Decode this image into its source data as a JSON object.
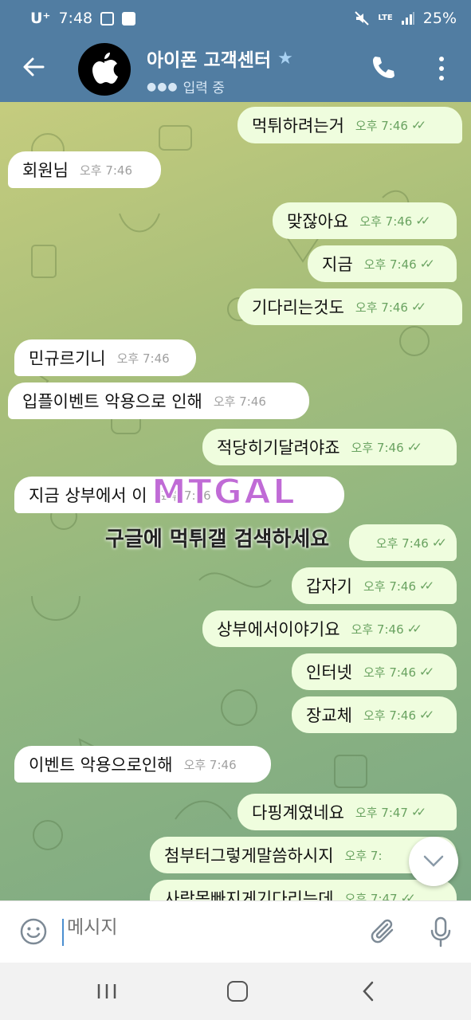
{
  "status_bar": {
    "carrier": "U⁺",
    "time": "7:48",
    "network": "LTE",
    "battery": "25%"
  },
  "header": {
    "title": "아이폰 고객센터",
    "subtitle": "입력 중"
  },
  "messages": [
    {
      "dir": "out",
      "text": "먹튀하려는거",
      "time": "오후 7:46",
      "read": true
    },
    {
      "dir": "in",
      "text": "회원님",
      "time": "오후 7:46"
    },
    {
      "dir": "out",
      "text": "맞잖아요",
      "time": "오후 7:46",
      "read": true
    },
    {
      "dir": "out",
      "text": "지금",
      "time": "오후 7:46",
      "read": true
    },
    {
      "dir": "out",
      "text": "기다리는것도",
      "time": "오후 7:46",
      "read": true
    },
    {
      "dir": "in",
      "text": "민규르기니",
      "time": "오후 7:46"
    },
    {
      "dir": "in",
      "text": "입플이벤트 악용으로 인해",
      "time": "오후 7:46"
    },
    {
      "dir": "out",
      "text": "적당히기달려야죠",
      "time": "오후 7:46",
      "read": true
    },
    {
      "dir": "in",
      "text": "지금 상부에서 이",
      "time": "오후 7:46"
    },
    {
      "dir": "out",
      "text": "",
      "time": "오후 7:46",
      "read": true
    },
    {
      "dir": "out",
      "text": "갑자기",
      "time": "오후 7:46",
      "read": true
    },
    {
      "dir": "out",
      "text": "상부에서이야기요",
      "time": "오후 7:46",
      "read": true
    },
    {
      "dir": "out",
      "text": "인터넷",
      "time": "오후 7:46",
      "read": true
    },
    {
      "dir": "out",
      "text": "장교체",
      "time": "오후 7:46",
      "read": true
    },
    {
      "dir": "in",
      "text": "이벤트 악용으로인해",
      "time": "오후 7:46"
    },
    {
      "dir": "out",
      "text": "다핑계였네요",
      "time": "오후 7:47",
      "read": true
    },
    {
      "dir": "out",
      "text": "첨부터그렇게말씀하시지",
      "time": "오후 7:",
      "read": true
    },
    {
      "dir": "out",
      "text": "사람몸빠지게기다리는데",
      "time": "오후 7:47",
      "read": true
    }
  ],
  "watermark": {
    "logo": "MTGAL",
    "text": "구글에 먹튀갤 검색하세요"
  },
  "input": {
    "placeholder": "메시지"
  },
  "colors": {
    "header": "#517da2",
    "outgoing_bubble": "#effdde",
    "incoming_bubble": "#ffffff",
    "tick": "#6aa361"
  }
}
